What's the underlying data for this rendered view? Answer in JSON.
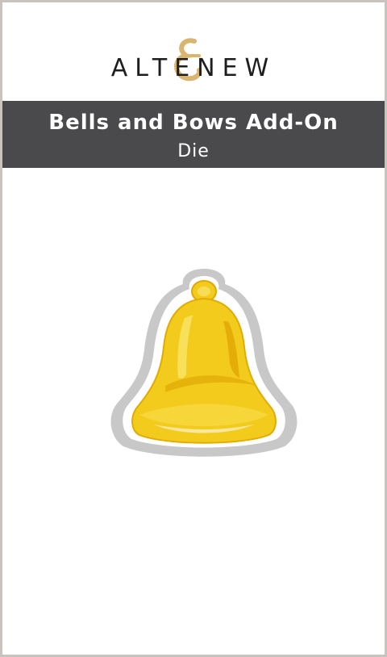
{
  "brand": {
    "name": "ALTENEW",
    "mark_color": "#d9b56f"
  },
  "banner": {
    "title": "Bells and Bows Add-On",
    "subtitle": "Die",
    "background": "#4a4a4c"
  },
  "artwork": {
    "subject": "bell-die",
    "fill_color": "#f3cb1d",
    "die_color": "#c8c8c8"
  }
}
